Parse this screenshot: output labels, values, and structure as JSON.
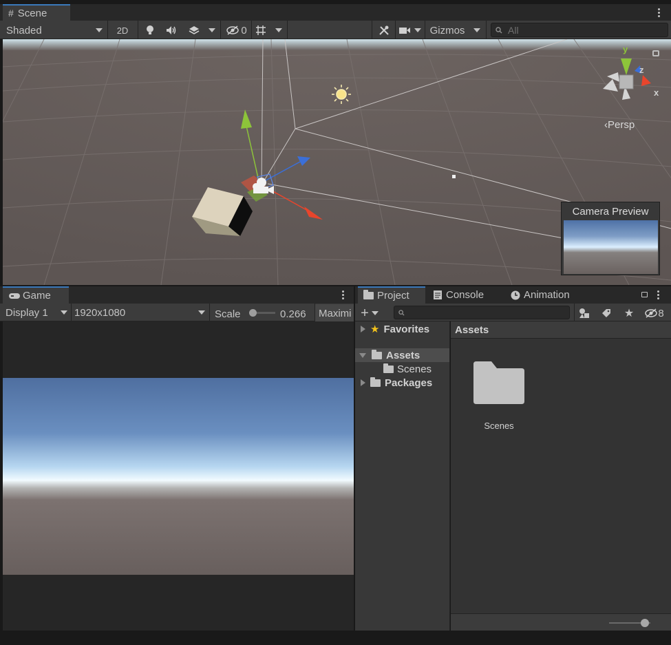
{
  "scene": {
    "tab_label": "Scene",
    "shading_mode": "Shaded",
    "btn_2d": "2D",
    "hidden_count": "0",
    "gizmos_label": "Gizmos",
    "search_placeholder": "All",
    "axis_y": "y",
    "axis_z": "z",
    "axis_x": "x",
    "persp_label": "‹Persp",
    "camera_preview_title": "Camera Preview"
  },
  "game": {
    "tab_label": "Game",
    "display": "Display 1",
    "resolution": "1920x1080",
    "scale_label": "Scale",
    "scale_value": "0.266",
    "maximize_label": "Maximi"
  },
  "project": {
    "tabs": [
      {
        "label": "Project"
      },
      {
        "label": "Console"
      },
      {
        "label": "Animation"
      }
    ],
    "hidden_count": "8",
    "tree": {
      "favorites": "Favorites",
      "assets": "Assets",
      "scenes": "Scenes",
      "packages": "Packages"
    },
    "breadcrumb": "Assets",
    "items": [
      {
        "name": "Scenes"
      }
    ],
    "zoom_slider_value": 0.8
  },
  "colors": {
    "accent": "#3a79bb",
    "selection": "#4d4d4d",
    "axis_y": "#8dc43a",
    "axis_x": "#e8452c",
    "axis_z": "#3b6fd8",
    "star": "#f3c31c"
  }
}
